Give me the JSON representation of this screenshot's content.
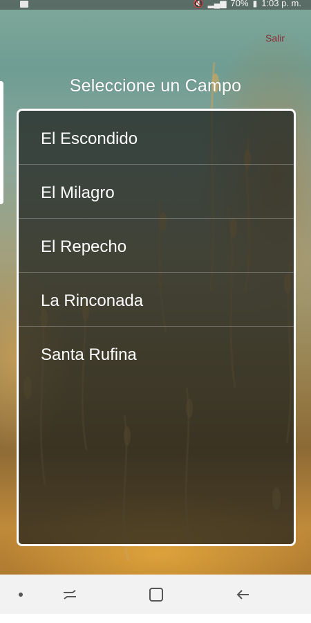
{
  "status_bar": {
    "battery": "70%",
    "time": "1:03 p. m."
  },
  "header": {
    "logout_label": "Salir",
    "title": "Seleccione un Campo"
  },
  "fields": [
    {
      "label": "El Escondido"
    },
    {
      "label": "El Milagro"
    },
    {
      "label": "El Repecho"
    },
    {
      "label": "La Rinconada"
    },
    {
      "label": "Santa Rufina"
    }
  ],
  "navigation": {
    "icons": [
      "recents-icon",
      "home-icon",
      "back-icon"
    ]
  },
  "colors": {
    "title_text": "#ffffff",
    "logout_text": "#8a2a36",
    "list_background": "#1c1e1c",
    "list_border": "#ffffff",
    "nav_background": "#f2f2f2"
  }
}
